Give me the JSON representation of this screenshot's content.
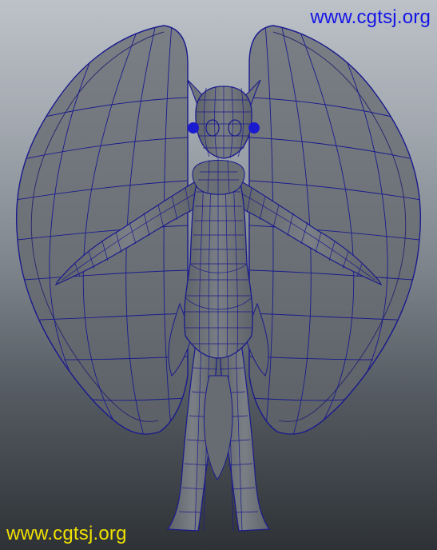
{
  "watermark": {
    "top_text": "www.cgtsj.org",
    "bottom_text": "www.cgtsj.org",
    "top_color": "#1414e6",
    "bottom_color": "#f0e000"
  },
  "viewport": {
    "subject": "wireframe-character-model",
    "background_top": "#bcc2c8",
    "background_bottom": "#2e3236",
    "wire_color": "#1a1a8c",
    "shaded_color": "#6f747a"
  }
}
